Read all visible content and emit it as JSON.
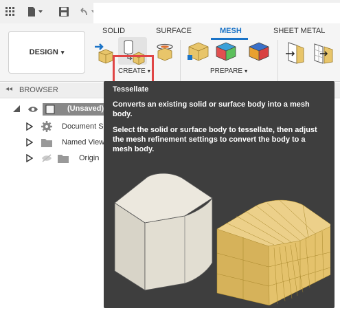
{
  "design_button": {
    "label": "DESIGN",
    "caret": "▾"
  },
  "tabs": [
    {
      "label": "SOLID"
    },
    {
      "label": "SURFACE"
    },
    {
      "label": "MESH",
      "active": true
    },
    {
      "label": "SHEET METAL"
    }
  ],
  "groups": {
    "create": {
      "label": "CREATE",
      "caret": "▾"
    },
    "prepare": {
      "label": "PREPARE",
      "caret": "▾"
    }
  },
  "browser": {
    "title": "BROWSER",
    "items": [
      {
        "label": "(Unsaved)",
        "icon": "component-icon"
      },
      {
        "label": "Document Se",
        "icon": "gear-icon"
      },
      {
        "label": "Named View",
        "icon": "folder-icon"
      },
      {
        "label": "Origin",
        "icon": "folder-icon"
      }
    ]
  },
  "tooltip": {
    "title": "Tessellate",
    "line1": "Converts an existing solid or surface body into a mesh body.",
    "line2": "Select the solid or surface body to tessellate, then adjust the mesh refinement settings to convert the body to a mesh body."
  },
  "colors": {
    "accent": "#1a73c7",
    "highlight": "#e04545",
    "tooltip_bg": "#3e3e3e",
    "mesh_gold": "#e8c56a"
  }
}
